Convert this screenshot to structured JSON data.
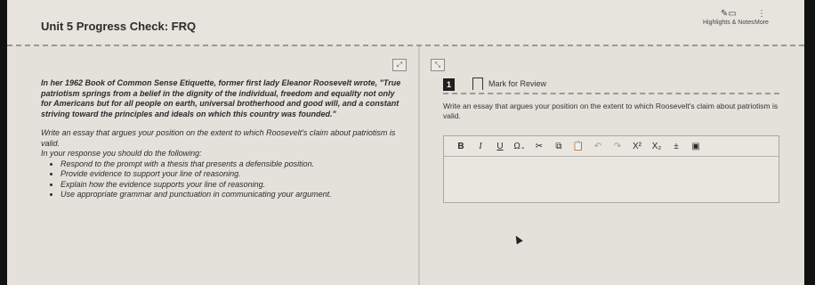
{
  "header": {
    "title": "Unit 5 Progress Check: FRQ",
    "highlights_label": "Highlights & Notes",
    "more_label": "More"
  },
  "stimulus": {
    "text": "In her 1962 Book of Common Sense Etiquette, former first lady Eleanor Roosevelt wrote, \"True patriotism springs from a belief in the dignity of the individual, freedom and equality not only for Americans but for all people on earth, universal brotherhood and good will, and a constant striving toward the principles and ideals on which this country was founded.\"",
    "prompt": "Write an essay that argues your position on the extent to which Roosevelt's claim about patriotism is valid.",
    "instructions_intro": "In your response you should do the following:",
    "bullets": [
      "Respond to the prompt with a thesis that presents a defensible position.",
      "Provide evidence to support your line of reasoning.",
      "Explain how the evidence supports your line of reasoning.",
      "Use appropriate grammar and punctuation in communicating your argument."
    ]
  },
  "question": {
    "number": "1",
    "mark_for_review": "Mark for Review",
    "text": "Write an essay that argues your position on the extent to which Roosevelt's claim about patriotism is valid."
  },
  "editor": {
    "bold": "B",
    "italic": "I",
    "underline": "U",
    "special_char": "Ω",
    "cut": "✂",
    "copy": "⧉",
    "paste": "📋",
    "undo": "↶",
    "redo": "↷",
    "superscript": "X²",
    "subscript": "X₂",
    "insert": "±",
    "image": "▣",
    "value": ""
  }
}
